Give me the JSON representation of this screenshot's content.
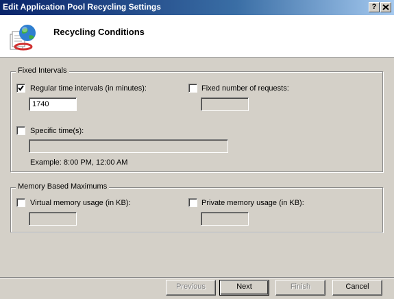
{
  "window": {
    "title": "Edit Application Pool Recycling Settings",
    "help_label": "?",
    "close_label": "X"
  },
  "header": {
    "title": "Recycling Conditions",
    "icon": "globe-pages-icon"
  },
  "fixed_intervals": {
    "legend": "Fixed Intervals",
    "regular_time": {
      "label": "Regular time intervals (in minutes):",
      "checked": true,
      "value": "1740"
    },
    "fixed_requests": {
      "label": "Fixed number of requests:",
      "checked": false,
      "value": ""
    },
    "specific_times": {
      "label": "Specific time(s):",
      "checked": false,
      "value": ""
    },
    "example": "Example: 8:00 PM, 12:00 AM"
  },
  "memory": {
    "legend": "Memory Based Maximums",
    "virtual": {
      "label": "Virtual memory usage (in KB):",
      "checked": false,
      "value": ""
    },
    "private": {
      "label": "Private memory usage (in KB):",
      "checked": false,
      "value": ""
    }
  },
  "buttons": {
    "previous": "Previous",
    "next": "Next",
    "finish": "Finish",
    "cancel": "Cancel"
  }
}
